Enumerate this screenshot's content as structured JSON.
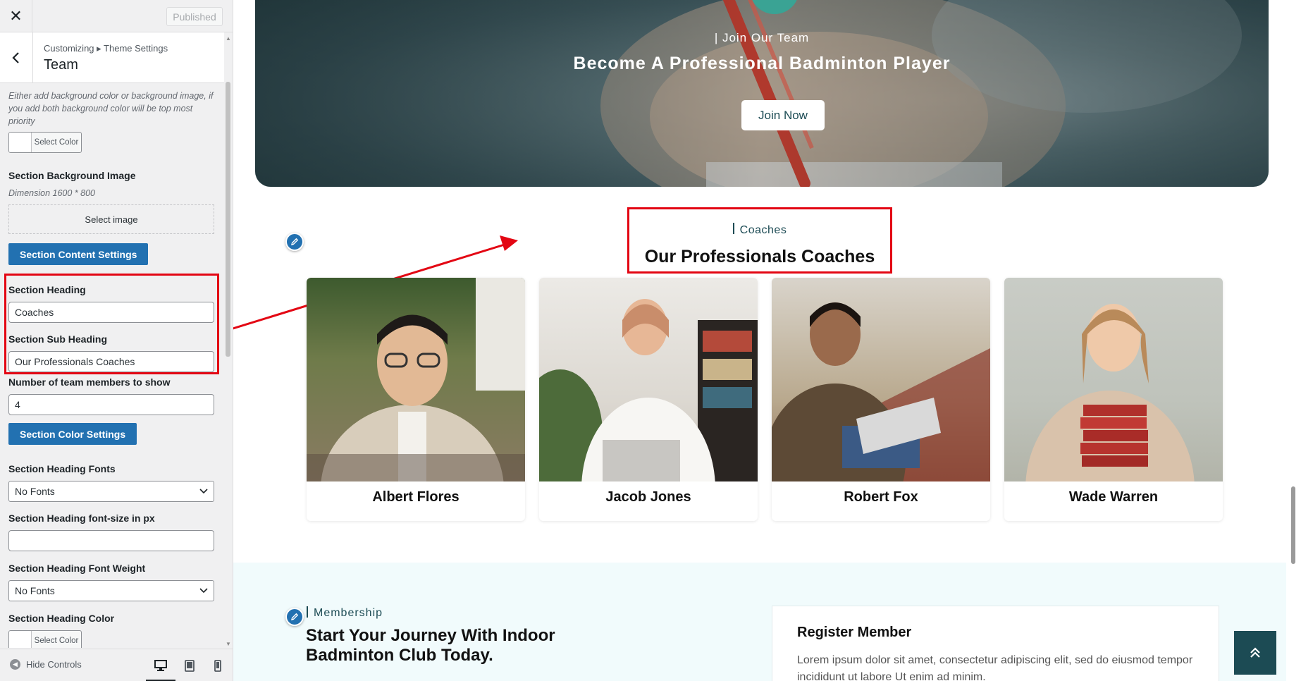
{
  "customizer": {
    "close_icon": "close-icon",
    "published_label": "Published",
    "breadcrumb": "Customizing ▸ Theme Settings",
    "section_title": "Team",
    "bg_description": "Either add background color or background image, if you add both background color will be top most priority",
    "select_color_label": "Select Color",
    "bg_image_label": "Section Background Image",
    "bg_image_dimension": "Dimension 1600 * 800",
    "select_image_label": "Select image",
    "content_settings_button": "Section Content Settings",
    "heading_label": "Section Heading",
    "heading_value": "Coaches",
    "subheading_label": "Section Sub Heading",
    "subheading_value": "Our Professionals Coaches",
    "members_count_label": "Number of team members to show",
    "members_count_value": "4",
    "color_settings_button": "Section Color Settings",
    "heading_fonts_label": "Section Heading Fonts",
    "heading_fonts_value": "No Fonts",
    "heading_fontsize_label": "Section Heading font-size in px",
    "heading_fontsize_value": "",
    "heading_weight_label": "Section Heading Font Weight",
    "heading_weight_value": "No Fonts",
    "heading_color_label": "Section Heading Color",
    "hide_controls_label": "Hide Controls"
  },
  "preview": {
    "hero": {
      "kicker": "| Join Our Team",
      "headline": "Become A Professional Badminton Player",
      "button": "Join Now"
    },
    "team": {
      "kicker": "Coaches",
      "title": "Our Professionals Coaches",
      "members": [
        {
          "name": "Albert Flores"
        },
        {
          "name": "Jacob Jones"
        },
        {
          "name": "Robert Fox"
        },
        {
          "name": "Wade Warren"
        }
      ]
    },
    "membership": {
      "kicker": "Membership",
      "title": "Start Your Journey With Indoor Badminton Club Today.",
      "register_title": "Register Member",
      "register_text": "Lorem ipsum dolor sit amet, consectetur adipiscing elit, sed do eiusmod tempor incididunt ut labore Ut enim ad minim."
    }
  },
  "colors": {
    "accent_blue": "#2271b1",
    "brand_teal": "#1c4b54",
    "highlight_red": "#e30613"
  }
}
